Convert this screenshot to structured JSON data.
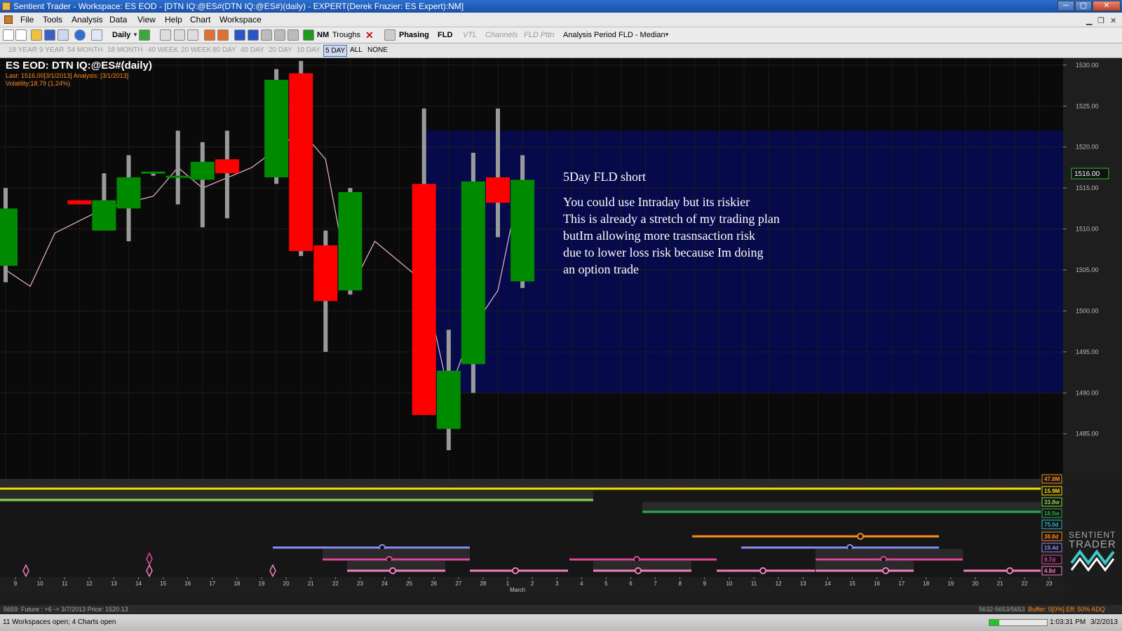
{
  "window": {
    "title": "Sentient Trader - Workspace: ES EOD - [DTN IQ:@ES#(DTN IQ:@ES#)(daily) - EXPERT(Derek Frazier: ES Expert):NM]"
  },
  "menu": [
    "File",
    "Tools",
    "Analysis",
    "Data",
    "View",
    "Help",
    "Chart",
    "Workspace"
  ],
  "toolbar": {
    "interval": "Daily",
    "nm": "NM",
    "troughs": "Troughs",
    "phasing": "Phasing",
    "fld": "FLD",
    "vtl": "VTL",
    "channels": "Channels",
    "fld_pttn": "FLD Pttn",
    "analysis_period": "Analysis Period",
    "fld_median": "FLD - Median"
  },
  "periods": [
    "18 YEAR",
    "9 YEAR",
    "54 MONTH",
    "18 MONTH",
    "40 WEEK",
    "20 WEEK",
    "80 DAY",
    "40 DAY",
    "20 DAY",
    "10 DAY",
    "5 DAY",
    "ALL",
    "NONE"
  ],
  "active_period": "5 DAY",
  "chart_header": {
    "title": "ES EOD: DTN IQ:@ES#(daily)",
    "line2": "Last: 1516.00[3/1/2013] Analysis: [3/1/2013]",
    "line3": "Volatility:18.79 (1.24%)"
  },
  "price_label": "1516.00",
  "annotation": [
    "5Day FLD short",
    "You could use Intraday but its riskier",
    "This is already a stretch of my trading plan",
    "butIm allowing more trasnsaction risk",
    "due to lower loss risk because Im doing",
    "an option trade"
  ],
  "cycle_labels": [
    {
      "text": "47.8M",
      "color": "#ff8c1a"
    },
    {
      "text": "15.9M",
      "color": "#ffe000"
    },
    {
      "text": "33.8w",
      "color": "#8ad94a"
    },
    {
      "text": "18.5w",
      "color": "#22b04a"
    },
    {
      "text": "75.0d",
      "color": "#2fb7c9"
    },
    {
      "text": "38.8d",
      "color": "#ff8c1a"
    },
    {
      "text": "19.4d",
      "color": "#8a8cf0"
    },
    {
      "text": "9.7d",
      "color": "#e0479a"
    },
    {
      "text": "4.8d",
      "color": "#f27fc0"
    }
  ],
  "x_axis": {
    "labels": [
      "9",
      "10",
      "11",
      "12",
      "13",
      "14",
      "15",
      "16",
      "17",
      "18",
      "19",
      "20",
      "21",
      "22",
      "23",
      "24",
      "25",
      "26",
      "27",
      "28",
      "1",
      "2",
      "3",
      "4",
      "5",
      "6",
      "7",
      "8",
      "9",
      "10",
      "11",
      "12",
      "13",
      "14",
      "15",
      "16",
      "17",
      "18",
      "19",
      "20",
      "21",
      "22",
      "23"
    ],
    "month_label": "March"
  },
  "brand": {
    "line1": "SENTIENT",
    "line2": "TRADER"
  },
  "status": {
    "left": "5659: Future : +6 -> 3/7/2013 Price: 1520.13",
    "right_range": "5632-5653/5653",
    "right_buffer": "Buffer: 0[0%] Eff: 50% ADQ"
  },
  "taskbar": {
    "left": "11 Workspaces open; 4 Charts open",
    "time": "1:03:31 PM",
    "date": "3/2/2013"
  },
  "colors": {
    "up": "#008a00",
    "down": "#ff0000",
    "fld": "#f0b7c8",
    "band": "#06094a",
    "price_bg": "#0a0a0a"
  },
  "chart_data": {
    "type": "candlestick",
    "title": "ES EOD: DTN IQ:@ES#(daily)",
    "y_range": [
      1480,
      1531
    ],
    "y_ticks": [
      1485.0,
      1490.0,
      1495.0,
      1500.0,
      1505.0,
      1510.0,
      1515.0,
      1520.0,
      1525.0,
      1530.0
    ],
    "candles": [
      {
        "i": 0,
        "x": "8",
        "open": 1505.5,
        "high": 1515.0,
        "low": 1503.5,
        "close": 1512.5
      },
      {
        "i": 3,
        "x": "11",
        "open": 1513.5,
        "high": 1513.5,
        "low": 1513.0,
        "close": 1513.0
      },
      {
        "i": 4,
        "x": "12",
        "open": 1509.8,
        "high": 1516.8,
        "low": 1509.8,
        "close": 1513.5
      },
      {
        "i": 5,
        "x": "13",
        "open": 1512.5,
        "high": 1519.0,
        "low": 1508.5,
        "close": 1516.3
      },
      {
        "i": 6,
        "x": "14",
        "open": 1516.8,
        "high": 1517.0,
        "low": 1516.5,
        "close": 1517.0
      },
      {
        "i": 7,
        "x": "15",
        "open": 1516.5,
        "high": 1522.0,
        "low": 1513.0,
        "close": 1516.5
      },
      {
        "i": 8,
        "x": "14b",
        "open": 1516.0,
        "high": 1520.6,
        "low": 1510.2,
        "close": 1518.2
      },
      {
        "i": 9,
        "x": "15b",
        "open": 1518.5,
        "high": 1522.0,
        "low": 1511.3,
        "close": 1516.8
      },
      {
        "i": 11,
        "x": "19",
        "open": 1516.3,
        "high": 1529.5,
        "low": 1515.5,
        "close": 1528.2
      },
      {
        "i": 12,
        "x": "20",
        "open": 1529.0,
        "high": 1530.5,
        "low": 1506.7,
        "close": 1507.3
      },
      {
        "i": 13,
        "x": "21",
        "open": 1508.0,
        "high": 1509.8,
        "low": 1495.0,
        "close": 1501.2
      },
      {
        "i": 14,
        "x": "22",
        "open": 1502.5,
        "high": 1515.0,
        "low": 1502.0,
        "close": 1514.5
      },
      {
        "i": 17,
        "x": "25",
        "open": 1515.5,
        "high": 1524.7,
        "low": 1487.3,
        "close": 1487.3
      },
      {
        "i": 18,
        "x": "26",
        "open": 1485.6,
        "high": 1497.7,
        "low": 1483.0,
        "close": 1492.7
      },
      {
        "i": 19,
        "x": "27",
        "open": 1493.5,
        "high": 1519.3,
        "low": 1490.0,
        "close": 1515.8
      },
      {
        "i": 20,
        "x": "28",
        "open": 1516.3,
        "high": 1524.7,
        "low": 1509.0,
        "close": 1513.2
      },
      {
        "i": 21,
        "x": "1",
        "open": 1503.6,
        "high": 1519.0,
        "low": 1502.8,
        "close": 1516.0
      }
    ],
    "fld": [
      {
        "i": 0,
        "y": 1505.0
      },
      {
        "i": 1,
        "y": 1503.0
      },
      {
        "i": 2,
        "y": 1509.5
      },
      {
        "i": 4,
        "y": 1512.5
      },
      {
        "i": 6,
        "y": 1514.0
      },
      {
        "i": 7,
        "y": 1517.5
      },
      {
        "i": 8,
        "y": 1515.0
      },
      {
        "i": 10,
        "y": 1517.5
      },
      {
        "i": 12,
        "y": 1522.0
      },
      {
        "i": 13,
        "y": 1518.5
      },
      {
        "i": 14,
        "y": 1502.5
      },
      {
        "i": 15,
        "y": 1508.5
      },
      {
        "i": 17,
        "y": 1503.5
      },
      {
        "i": 18,
        "y": 1490.0
      },
      {
        "i": 19,
        "y": 1498.0
      },
      {
        "i": 20,
        "y": 1502.5
      },
      {
        "i": 21,
        "y": 1517.0
      }
    ],
    "target_band": [
      1490,
      1522
    ],
    "last_price": 1516.0
  }
}
